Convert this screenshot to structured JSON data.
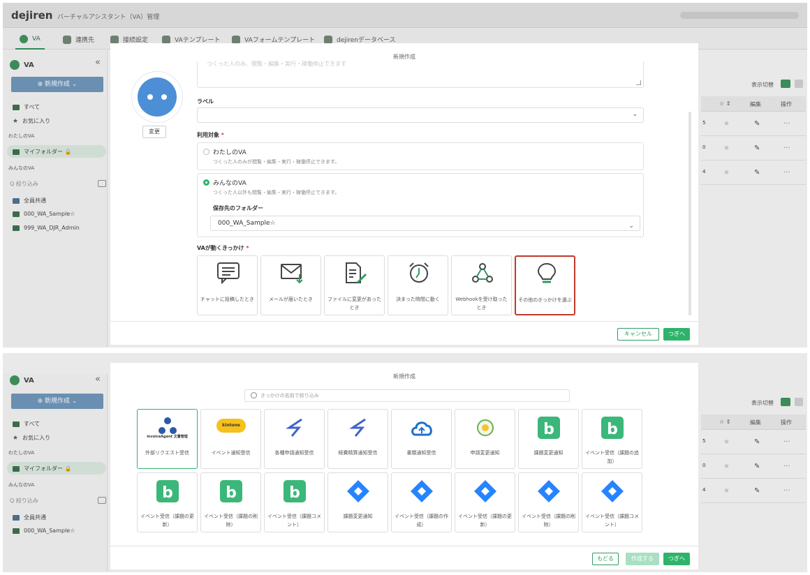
{
  "app": {
    "brand": "dejiren",
    "title": "バーチャルアシスタント（VA）管理",
    "tabs": [
      "VA",
      "連携先",
      "接続設定",
      "VAテンプレート",
      "VAフォームテンプレート",
      "dejirenデータベース"
    ]
  },
  "sidebar": {
    "header": "VA",
    "collapse": "«",
    "new_button": "⊕ 新規作成 ⌄",
    "all": "すべて",
    "favorites": "お気に入り",
    "my_va": "わたしのVA",
    "my_folder": "マイフォルダー 🔒",
    "all_va": "みんなのVA",
    "filter_placeholder": "Q 絞り込み",
    "folders": [
      "全員共通",
      "000_WA_Sample☆",
      "999_WA_DJR_Admin"
    ],
    "folders2": [
      "全員共通",
      "000_WA_Sample☆"
    ]
  },
  "right": {
    "toggle_label": "表示切替",
    "cols": {
      "star": "☆ ⇕",
      "edit": "編集",
      "ops": "操作"
    },
    "row_values": [
      "5",
      "0",
      "4"
    ]
  },
  "modal": {
    "title": "新規作成",
    "faded_text": "つくった人のみ、閲覧・編集・実行・稼働停止できます",
    "label_field": "ラベル",
    "change_button": "変更",
    "target_label": "利用対象",
    "required_mark": "*",
    "option_mine": {
      "title": "わたしのVA",
      "desc": "つくった人のみが閲覧・編集・実行・稼働停止できます。"
    },
    "option_everyone": {
      "title": "みんなのVA",
      "desc": "つくった人以外も閲覧・編集・実行・稼働停止できます。"
    },
    "folder_label": "保存先のフォルダー",
    "folder_value": "000_WA_Sample☆",
    "trigger_label": "VAが動くきっかけ",
    "triggers": [
      {
        "label": "チャットに投稿したとき",
        "icon": "chat-icon"
      },
      {
        "label": "メールが届いたとき",
        "icon": "mail-icon"
      },
      {
        "label": "ファイルに変更があったとき",
        "icon": "file-edit-icon"
      },
      {
        "label": "決まった時間に動く",
        "icon": "alarm-clock-icon"
      },
      {
        "label": "Webhookを受け取ったとき",
        "icon": "webhook-icon"
      },
      {
        "label": "その他のきっかけを選ぶ",
        "icon": "lightbulb-icon"
      }
    ],
    "cancel": "キャンセル",
    "next": "つぎへ"
  },
  "modal2": {
    "title": "新規作成",
    "search_placeholder": "きっかけの名前で絞り込み",
    "items": [
      {
        "label": "外部リクエスト受信",
        "icon": "invoiceagent-logo-icon",
        "logo_text": "invoiceAgent 文書管理"
      },
      {
        "label": "イベント通知受信",
        "icon": "kintone-logo-icon",
        "logo_text": "kintone"
      },
      {
        "label": "各種申請通知受信",
        "icon": "arrow-logo-icon"
      },
      {
        "label": "経費精算通知受信",
        "icon": "arrow-logo-icon"
      },
      {
        "label": "書類通知受信",
        "icon": "cloud-logo-icon"
      },
      {
        "label": "申請変更通知",
        "icon": "round-logo-icon"
      },
      {
        "label": "課題変更通知",
        "icon": "backlog-icon"
      },
      {
        "label": "イベント受信（課題の追加）",
        "icon": "backlog-icon"
      },
      {
        "label": "イベント受信（課題の更新）",
        "icon": "backlog-icon"
      },
      {
        "label": "イベント受信（課題の削除）",
        "icon": "backlog-icon"
      },
      {
        "label": "イベント受信（課題コメント）",
        "icon": "backlog-icon"
      },
      {
        "label": "課題変更通知",
        "icon": "jira-icon"
      },
      {
        "label": "イベント受信（課題の作成）",
        "icon": "jira-icon"
      },
      {
        "label": "イベント受信（課題の更新）",
        "icon": "jira-icon"
      },
      {
        "label": "イベント受信（課題の削除）",
        "icon": "jira-icon"
      },
      {
        "label": "イベント受信（課題コメント）",
        "icon": "jira-icon"
      }
    ],
    "back": "もどる",
    "create": "作成する",
    "next": "つぎへ"
  },
  "colors": {
    "accent": "#2fb36b",
    "selected_border": "#c0392b",
    "avatar": "#4c8fd6",
    "backlog": "#3bb779",
    "jira": "#2684ff"
  }
}
